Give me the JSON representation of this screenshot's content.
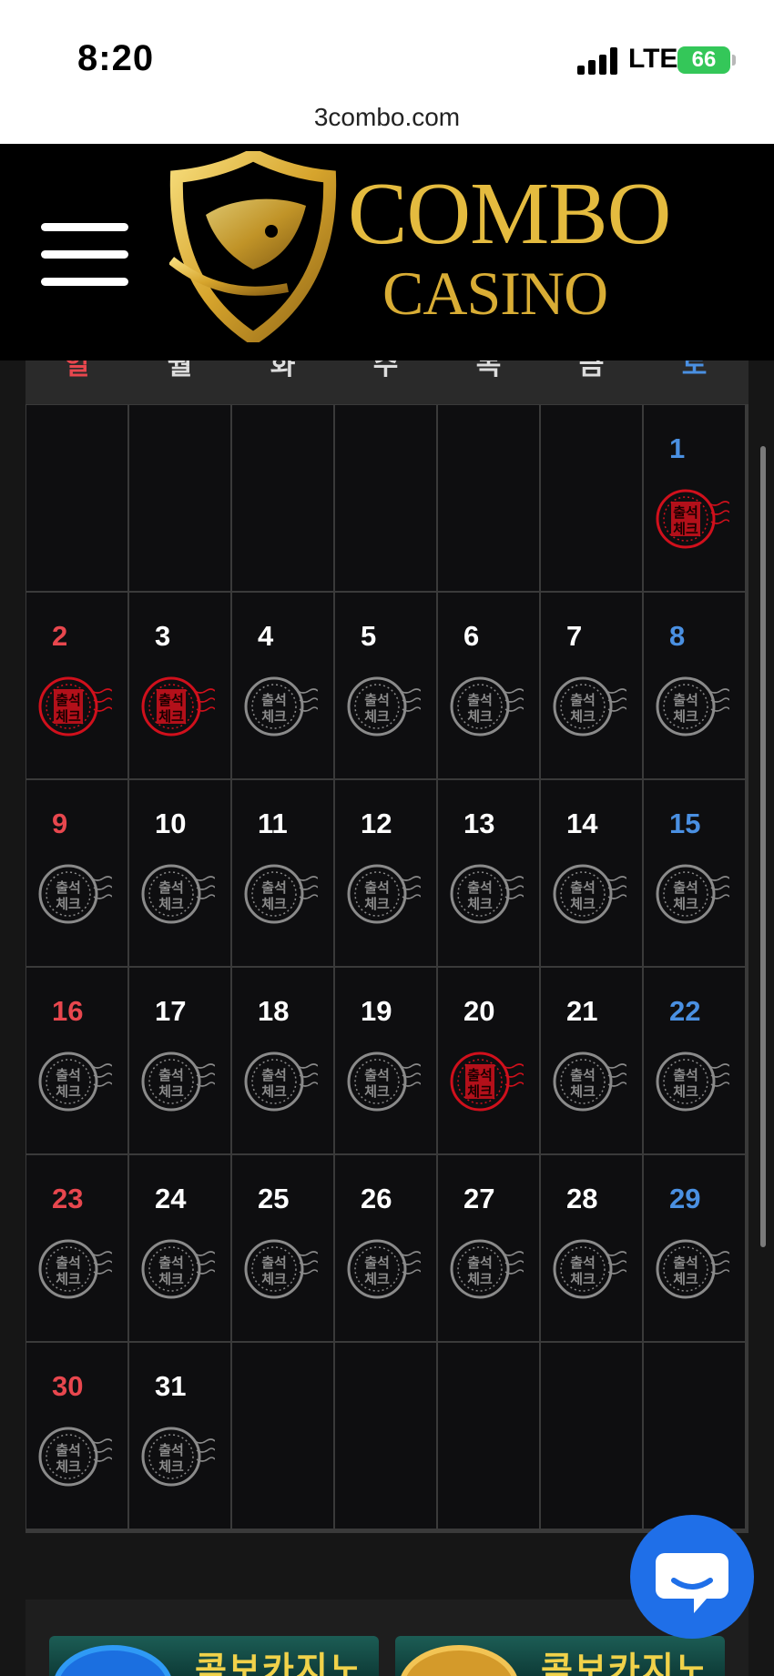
{
  "status_bar": {
    "time": "8:20",
    "network": "LTE",
    "battery": "66"
  },
  "browser": {
    "url": "3combo.com"
  },
  "header": {
    "logo_line1": "COMBO",
    "logo_line2": "CASINO"
  },
  "calendar": {
    "weekdays": [
      "일",
      "월",
      "화",
      "수",
      "목",
      "금",
      "토"
    ],
    "weeks": [
      [
        null,
        null,
        null,
        null,
        null,
        null,
        {
          "day": "1",
          "checked": true
        }
      ],
      [
        {
          "day": "2",
          "checked": true
        },
        {
          "day": "3",
          "checked": true
        },
        {
          "day": "4",
          "checked": false
        },
        {
          "day": "5",
          "checked": false
        },
        {
          "day": "6",
          "checked": false
        },
        {
          "day": "7",
          "checked": false
        },
        {
          "day": "8",
          "checked": false
        }
      ],
      [
        {
          "day": "9",
          "checked": false
        },
        {
          "day": "10",
          "checked": false
        },
        {
          "day": "11",
          "checked": false
        },
        {
          "day": "12",
          "checked": false
        },
        {
          "day": "13",
          "checked": false
        },
        {
          "day": "14",
          "checked": false
        },
        {
          "day": "15",
          "checked": false
        }
      ],
      [
        {
          "day": "16",
          "checked": false
        },
        {
          "day": "17",
          "checked": false
        },
        {
          "day": "18",
          "checked": false
        },
        {
          "day": "19",
          "checked": false
        },
        {
          "day": "20",
          "checked": true
        },
        {
          "day": "21",
          "checked": false
        },
        {
          "day": "22",
          "checked": false
        }
      ],
      [
        {
          "day": "23",
          "checked": false
        },
        {
          "day": "24",
          "checked": false
        },
        {
          "day": "25",
          "checked": false
        },
        {
          "day": "26",
          "checked": false
        },
        {
          "day": "27",
          "checked": false
        },
        {
          "day": "28",
          "checked": false
        },
        {
          "day": "29",
          "checked": false
        }
      ],
      [
        {
          "day": "30",
          "checked": false
        },
        {
          "day": "31",
          "checked": false
        },
        null,
        null,
        null,
        null,
        null
      ]
    ],
    "stamp_text_top": "출석",
    "stamp_text_bottom": "체크"
  },
  "promos": [
    "콤보카지노",
    "콤보카지노"
  ],
  "colors": {
    "gold": "#e4bb3f",
    "checked_stamp": "#d0101c",
    "unchecked_stamp": "#8a8a8a",
    "sunday": "#e8474e",
    "saturday": "#4a90e2",
    "chat": "#1f6fe8"
  },
  "icons": {
    "menu": "hamburger-icon",
    "logo": "shield-logo-icon",
    "chat": "chat-bubble-icon",
    "stamp": "attendance-stamp-icon"
  }
}
